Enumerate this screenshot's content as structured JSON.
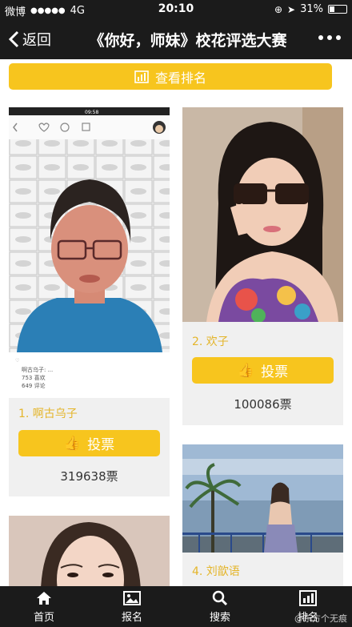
{
  "status_bar": {
    "carrier": "微博",
    "signal": "●●●●●",
    "network": "4G",
    "time": "20:10",
    "battery": "31%",
    "battery_level": 0.31
  },
  "nav": {
    "back_label": "返回",
    "title": "《你好，师妹》校花评选大赛"
  },
  "rank_button_label": "查看排名",
  "cards": [
    {
      "name": "1. 啊古乌子",
      "vote_label": "投票",
      "votes": "319638票"
    },
    {
      "name": "2. 欢子",
      "vote_label": "投票",
      "votes": "100086票"
    },
    {
      "name": "",
      "vote_label": "",
      "votes": ""
    },
    {
      "name": "4. 刘歆语",
      "vote_label": "",
      "votes": ""
    }
  ],
  "embedded_screenshot": {
    "time": "09:58",
    "stats": [
      "啊古乌子: ...",
      "753 喜欢",
      "649 评论"
    ]
  },
  "tabs": [
    {
      "label": "首页",
      "icon": "home-icon"
    },
    {
      "label": "报名",
      "icon": "image-icon"
    },
    {
      "label": "搜索",
      "icon": "search-icon"
    },
    {
      "label": "排名",
      "icon": "chart-icon"
    }
  ],
  "watermark": "@东方个无痕",
  "colors": {
    "accent": "#f7c51e",
    "bar": "#1b1b1b",
    "name": "#e4b52a"
  }
}
